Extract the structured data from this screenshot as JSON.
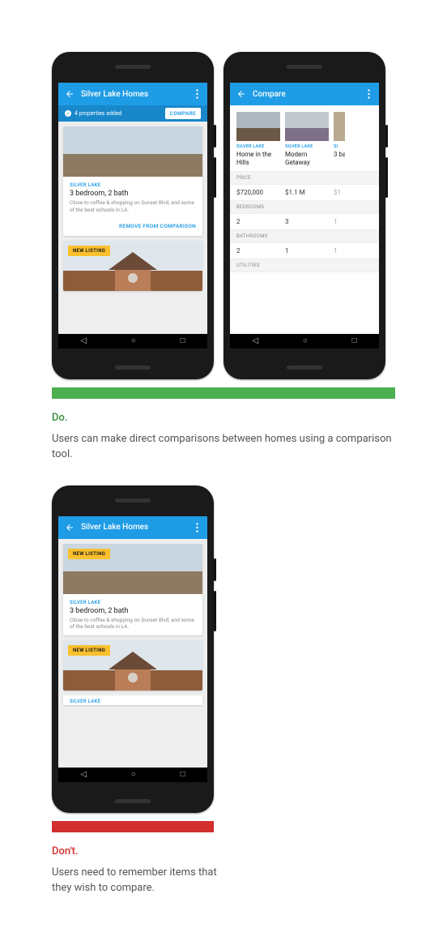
{
  "do": {
    "label": "Do.",
    "caption": "Users can make direct comparisons between homes using a comparison tool."
  },
  "dont": {
    "label": "Don't.",
    "caption": "Users need to remember items that they wish to compare."
  },
  "listScreen": {
    "appbar_title": "Silver Lake Homes",
    "subbar_text": "4 properties added",
    "compare_btn": "COMPARE",
    "card1": {
      "location": "SILVER LAKE",
      "title": "3 bedroom, 2 bath",
      "desc": "Close to coffee & shopping on Sunset Blvd, and some of the best schools in LA.",
      "action": "REMOVE FROM COMPARISON"
    },
    "card2": {
      "badge": "NEW LISTING"
    }
  },
  "compareScreen": {
    "appbar_title": "Compare",
    "columns": [
      {
        "location": "SILVER LAKE",
        "name": "Home in the Hills"
      },
      {
        "location": "SILVER LAKE",
        "name": "Modern Getaway"
      },
      {
        "location": "SI",
        "name": "3 ba"
      }
    ],
    "sections": {
      "price": {
        "label": "PRICE",
        "values": [
          "$720,000",
          "$1.1 M",
          "$1"
        ]
      },
      "bedrooms": {
        "label": "BEDROOMS",
        "values": [
          "2",
          "3",
          "1"
        ]
      },
      "bathrooms": {
        "label": "BATHROOMS",
        "values": [
          "2",
          "1",
          "1"
        ]
      },
      "utilities": {
        "label": "UTILITIES"
      }
    }
  },
  "dontScreen": {
    "appbar_title": "Silver Lake Homes",
    "card1": {
      "badge": "NEW LISTING",
      "location": "SILVER LAKE",
      "title": "3 bedroom, 2 bath",
      "desc": "Close to coffee & shopping on Sunset Blvd, and some of the best schools in LA."
    },
    "card2": {
      "badge": "NEW LISTING"
    }
  }
}
